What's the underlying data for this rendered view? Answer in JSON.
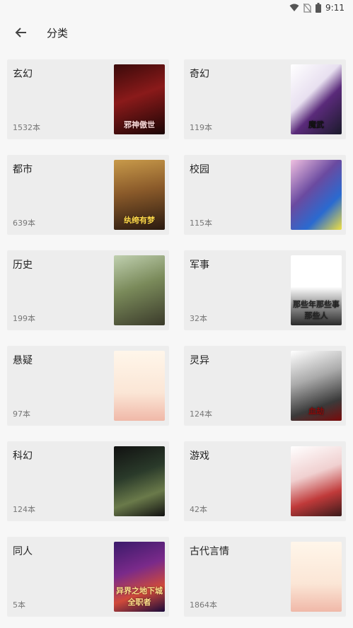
{
  "status": {
    "time": "9:11",
    "icons": [
      "wifi-icon",
      "no-sim-icon",
      "battery-icon"
    ]
  },
  "header": {
    "title": "分类",
    "back_icon": "arrow-back-icon"
  },
  "categories": [
    {
      "name": "玄幻",
      "count": "1532本",
      "cover_text": "邪神傲世"
    },
    {
      "name": "奇幻",
      "count": "119本",
      "cover_text": "魔武"
    },
    {
      "name": "都市",
      "count": "639本",
      "cover_text": "纨绔有梦"
    },
    {
      "name": "校园",
      "count": "115本",
      "cover_text": ""
    },
    {
      "name": "历史",
      "count": "199本",
      "cover_text": ""
    },
    {
      "name": "军事",
      "count": "32本",
      "cover_text": "那些年那些事那些人"
    },
    {
      "name": "悬疑",
      "count": "97本",
      "cover_text": ""
    },
    {
      "name": "灵异",
      "count": "124本",
      "cover_text": "血劫"
    },
    {
      "name": "科幻",
      "count": "124本",
      "cover_text": ""
    },
    {
      "name": "游戏",
      "count": "42本",
      "cover_text": ""
    },
    {
      "name": "同人",
      "count": "5本",
      "cover_text": "异界之地下城全职者"
    },
    {
      "name": "古代言情",
      "count": "1864本",
      "cover_text": ""
    }
  ]
}
